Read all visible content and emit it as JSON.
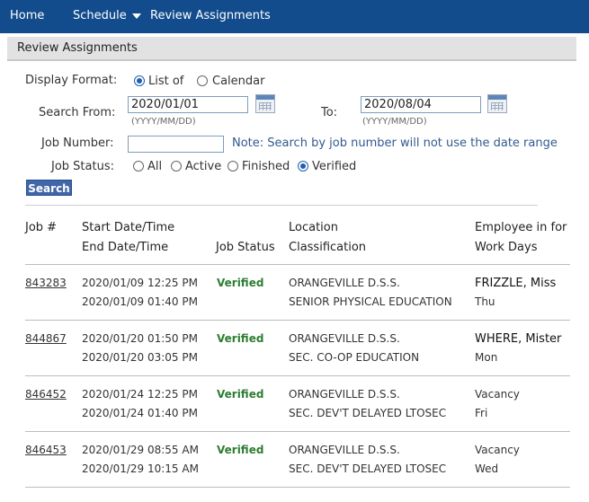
{
  "nav": {
    "home": "Home",
    "schedule": "Schedule",
    "review": "Review Assignments"
  },
  "page_title": "Review Assignments",
  "form": {
    "display_format_label": "Display Format:",
    "display_options": [
      "List of",
      "Calendar"
    ],
    "display_selected": "List of",
    "search_from_label": "Search From:",
    "search_from_value": "2020/01/01",
    "search_to_label": "To:",
    "search_to_value": "2020/08/04",
    "date_hint": "(YYYY/MM/DD)",
    "job_number_label": "Job Number:",
    "job_number_value": "",
    "job_number_note": "Note: Search by job number will not use the date range",
    "job_status_label": "Job Status:",
    "job_status_options": [
      "All",
      "Active",
      "Finished",
      "Verified"
    ],
    "job_status_selected": "Verified",
    "search_button": "Search"
  },
  "table": {
    "headers": {
      "job": "Job #",
      "start": "Start Date/Time",
      "end": "End Date/Time",
      "status": "Job Status",
      "location": "Location",
      "classification": "Classification",
      "employee": "Employee in for",
      "workdays": "Work Days"
    },
    "rows": [
      {
        "job": "843283",
        "start": "2020/01/09 12:25 PM",
        "end": "2020/01/09 01:40 PM",
        "status": "Verified",
        "location": "ORANGEVILLE D.S.S.",
        "classification": "SENIOR PHYSICAL EDUCATION",
        "employee": "FRIZZLE, Miss",
        "days": "Thu"
      },
      {
        "job": "844867",
        "start": "2020/01/20 01:50 PM",
        "end": "2020/01/20 03:05 PM",
        "status": "Verified",
        "location": "ORANGEVILLE D.S.S.",
        "classification": "SEC. CO-OP EDUCATION",
        "employee": "WHERE, Mister",
        "days": "Mon"
      },
      {
        "job": "846452",
        "start": "2020/01/24 12:25 PM",
        "end": "2020/01/24 01:40 PM",
        "status": "Verified",
        "location": "ORANGEVILLE D.S.S.",
        "classification": "SEC. DEV'T DELAYED LTOSEC",
        "employee": "Vacancy",
        "days": "Fri"
      },
      {
        "job": "846453",
        "start": "2020/01/29 08:55 AM",
        "end": "2020/01/29 10:15 AM",
        "status": "Verified",
        "location": "ORANGEVILLE D.S.S.",
        "classification": "SEC. DEV'T DELAYED LTOSEC",
        "employee": "Vacancy",
        "days": "Wed"
      }
    ]
  },
  "colors": {
    "nav_bg": "#124c8c",
    "verified": "#2e7d32",
    "note": "#315a8f",
    "button": "#3f66a8"
  }
}
